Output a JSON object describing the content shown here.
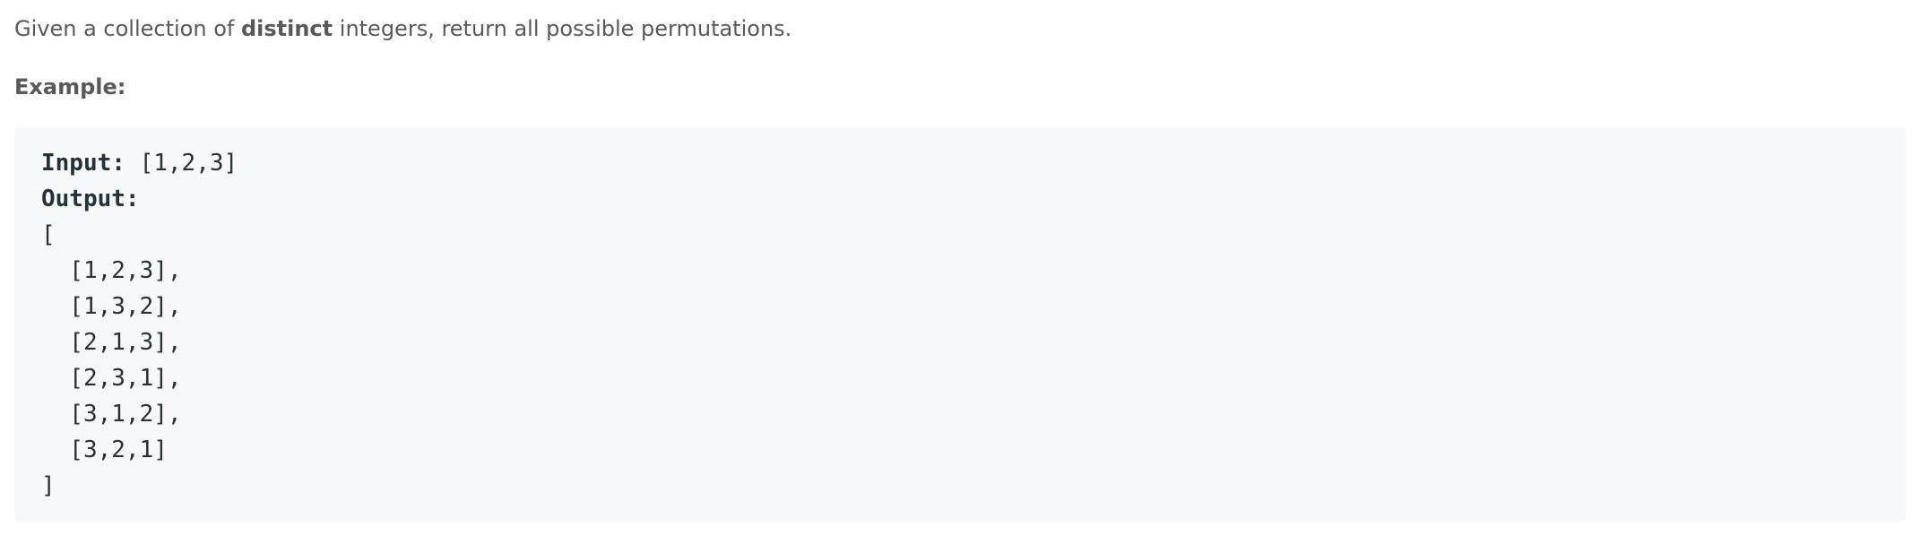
{
  "description": {
    "prefix": "Given a collection of ",
    "emphasis": "distinct",
    "suffix": " integers, return all possible permutations."
  },
  "example": {
    "label": "Example:",
    "input_label": "Input:",
    "input_value": " [1,2,3]",
    "output_label": "Output:",
    "open_bracket": "[",
    "rows": [
      "  [1,2,3],",
      "  [1,3,2],",
      "  [2,1,3],",
      "  [2,3,1],",
      "  [3,1,2],",
      "  [3,2,1]"
    ],
    "close_bracket": "]"
  }
}
